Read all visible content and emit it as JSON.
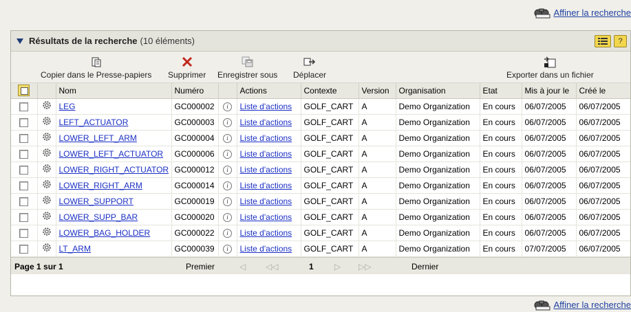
{
  "refine_link": "Affiner la recherche",
  "panel": {
    "title": "Résultats de la recherche",
    "count": "(10 éléments)"
  },
  "toolbar": {
    "copy_label": "Copier dans le Presse-papiers",
    "delete_label": "Supprimer",
    "save_label": "Enregistrer sous",
    "move_label": "Déplacer",
    "export_label": "Exporter dans un fichier"
  },
  "columns": {
    "name": "Nom",
    "number": "Numéro",
    "actions": "Actions",
    "context": "Contexte",
    "version": "Version",
    "organisation": "Organisation",
    "state": "Etat",
    "updated": "Mis à jour le",
    "created": "Créé le"
  },
  "rows": [
    {
      "name": "LEG",
      "number": "GC000002",
      "actions": "Liste d'actions",
      "context": "GOLF_CART",
      "version": "A",
      "organisation": "Demo Organization",
      "state": "En cours",
      "updated": "06/07/2005",
      "created": "06/07/2005"
    },
    {
      "name": "LEFT_ACTUATOR",
      "number": "GC000003",
      "actions": "Liste d'actions",
      "context": "GOLF_CART",
      "version": "A",
      "organisation": "Demo Organization",
      "state": "En cours",
      "updated": "06/07/2005",
      "created": "06/07/2005"
    },
    {
      "name": "LOWER_LEFT_ARM",
      "number": "GC000004",
      "actions": "Liste d'actions",
      "context": "GOLF_CART",
      "version": "A",
      "organisation": "Demo Organization",
      "state": "En cours",
      "updated": "06/07/2005",
      "created": "06/07/2005"
    },
    {
      "name": "LOWER_LEFT_ACTUATOR",
      "number": "GC000006",
      "actions": "Liste d'actions",
      "context": "GOLF_CART",
      "version": "A",
      "organisation": "Demo Organization",
      "state": "En cours",
      "updated": "06/07/2005",
      "created": "06/07/2005"
    },
    {
      "name": "LOWER_RIGHT_ACTUATOR",
      "number": "GC000012",
      "actions": "Liste d'actions",
      "context": "GOLF_CART",
      "version": "A",
      "organisation": "Demo Organization",
      "state": "En cours",
      "updated": "06/07/2005",
      "created": "06/07/2005"
    },
    {
      "name": "LOWER_RIGHT_ARM",
      "number": "GC000014",
      "actions": "Liste d'actions",
      "context": "GOLF_CART",
      "version": "A",
      "organisation": "Demo Organization",
      "state": "En cours",
      "updated": "06/07/2005",
      "created": "06/07/2005"
    },
    {
      "name": "LOWER_SUPPORT",
      "number": "GC000019",
      "actions": "Liste d'actions",
      "context": "GOLF_CART",
      "version": "A",
      "organisation": "Demo Organization",
      "state": "En cours",
      "updated": "06/07/2005",
      "created": "06/07/2005"
    },
    {
      "name": "LOWER_SUPP_BAR",
      "number": "GC000020",
      "actions": "Liste d'actions",
      "context": "GOLF_CART",
      "version": "A",
      "organisation": "Demo Organization",
      "state": "En cours",
      "updated": "06/07/2005",
      "created": "06/07/2005"
    },
    {
      "name": "LOWER_BAG_HOLDER",
      "number": "GC000022",
      "actions": "Liste d'actions",
      "context": "GOLF_CART",
      "version": "A",
      "organisation": "Demo Organization",
      "state": "En cours",
      "updated": "06/07/2005",
      "created": "06/07/2005"
    },
    {
      "name": "LT_ARM",
      "number": "GC000039",
      "actions": "Liste d'actions",
      "context": "GOLF_CART",
      "version": "A",
      "organisation": "Demo Organization",
      "state": "En cours",
      "updated": "07/07/2005",
      "created": "06/07/2005"
    }
  ],
  "pager": {
    "label": "Page 1 sur 1",
    "first": "Premier",
    "current": "1",
    "last": "Dernier"
  },
  "colors": {
    "link": "#1a2fc4",
    "header_bg": "#e5e4dc",
    "accent_button": "#f2d64c",
    "delete_icon": "#c0281c"
  }
}
